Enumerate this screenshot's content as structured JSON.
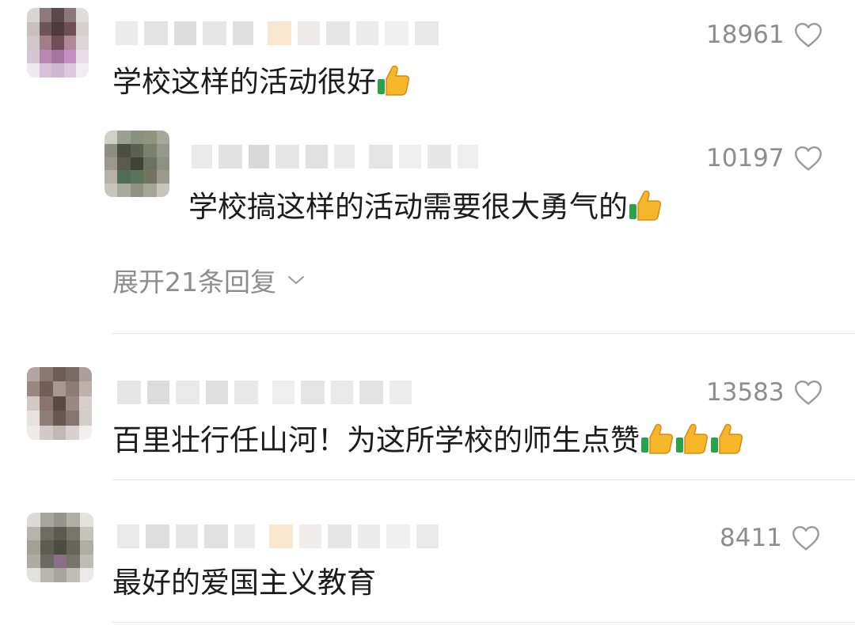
{
  "comments": [
    {
      "text": "学校这样的活动很好",
      "likes": "18961",
      "thumbs": 1
    },
    {
      "text": "学校搞这样的活动需要很大勇气的",
      "likes": "10197",
      "thumbs": 1,
      "is_reply": true
    },
    {
      "text": "百里壮行任山河！为这所学校的师生点赞",
      "likes": "13583",
      "thumbs": 3
    },
    {
      "text": "最好的爱国主义教育",
      "likes": "8411",
      "thumbs": 0
    }
  ],
  "expand_replies_label": "展开21条回复",
  "icons": {
    "like": "heart-outline-icon",
    "emoji": "thumbs-up-emoji",
    "expand": "chevron-down-icon"
  },
  "colors": {
    "meta_text": "#8d8d8d",
    "body_text": "#1c1c1c",
    "divider": "#e7e7e7"
  }
}
